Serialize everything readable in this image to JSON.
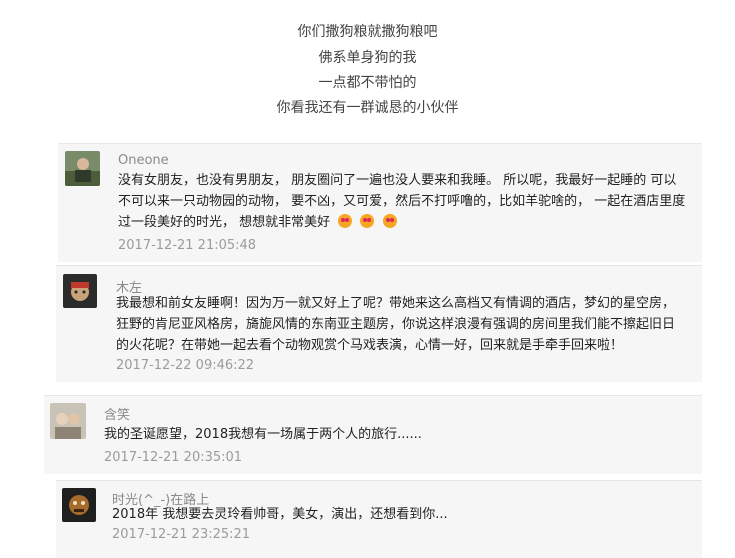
{
  "intro": {
    "lines": [
      "你们撒狗粮就撒狗粮吧",
      "佛系单身狗的我",
      "一点都不带怕的",
      "你看我还有一群诚恳的小伙伴"
    ]
  },
  "comments": [
    {
      "name": "Oneone",
      "lines": [
        "没有女朋友，也没有男朋友， 朋友圈问了一遍也没人要来和我睡。 所以呢，我最好一起睡的 可以",
        "不可以来一只动物园的动物， 要不凶，又可爱，然后不打呼噜的，比如羊驼啥的， 一起在酒店里度",
        "过一段美好的时光， 想想就非常美好"
      ],
      "emoji_count": 3,
      "emoji_icon": "heart-eyes-emoji-icon",
      "time": "2017-12-21 21:05:48"
    },
    {
      "name": "木左",
      "lines": [
        "我最想和前女友睡啊！因为万一就又好上了呢？带她来这么高档又有情调的酒店，梦幻的星空房，",
        "狂野的肯尼亚风格房，旖旎风情的东南亚主题房，你说这样浪漫有强调的房间里我们能不擦起旧日",
        "的火花呢？在带她一起去看个动物观赏个马戏表演，心情一好，回来就是手牵手回来啦！"
      ],
      "time": "2017-12-22 09:46:22"
    },
    {
      "name": "含笑",
      "lines": [
        "我的圣诞愿望，2018我想有一场属于两个人的旅行......"
      ],
      "time": "2017-12-21 20:35:01"
    },
    {
      "name": "时光(^_-)在路上",
      "lines": [
        "2018年 我想要去灵玲看帅哥，美女，演出，还想看到你..."
      ],
      "time": "2017-12-21 23:25:21"
    }
  ],
  "colors": {
    "name": "#8a8a8a",
    "time": "#9b9b9b",
    "panel": "#f6f6f6",
    "divider": "#e6e6e6"
  }
}
